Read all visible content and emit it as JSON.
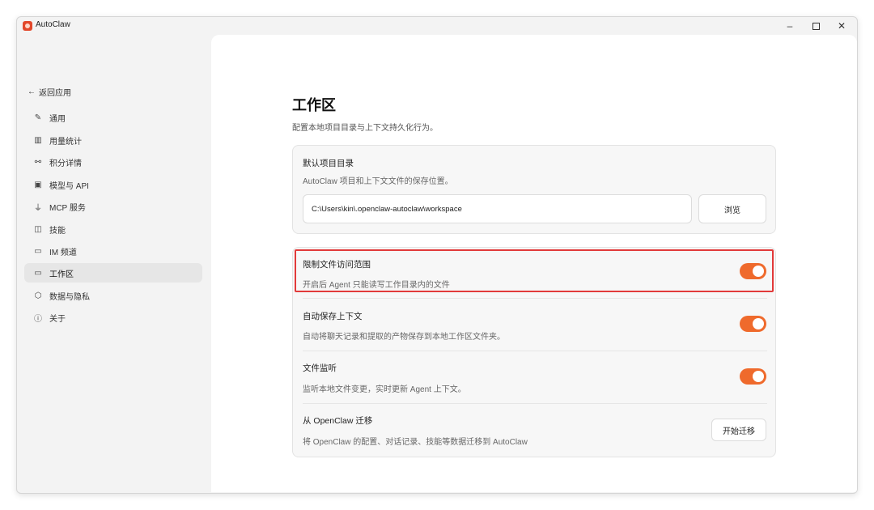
{
  "window": {
    "title": "AutoClaw",
    "minimize": "–",
    "close": "✕"
  },
  "sidebar": {
    "back_label": "返回应用",
    "back_icon": "←",
    "items": [
      {
        "label": "通用",
        "icon": "edit-icon",
        "glyph": "✎"
      },
      {
        "label": "用量统计",
        "icon": "bar-chart-icon",
        "glyph": "▥"
      },
      {
        "label": "积分详情",
        "icon": "link-icon",
        "glyph": "⚯"
      },
      {
        "label": "模型与 API",
        "icon": "chip-icon",
        "glyph": "▣"
      },
      {
        "label": "MCP 服务",
        "icon": "plug-icon",
        "glyph": "⏚"
      },
      {
        "label": "技能",
        "icon": "book-icon",
        "glyph": "◫"
      },
      {
        "label": "IM 频道",
        "icon": "chat-icon",
        "glyph": "▭"
      },
      {
        "label": "工作区",
        "icon": "folder-icon",
        "glyph": "▭"
      },
      {
        "label": "数据与隐私",
        "icon": "shield-icon",
        "glyph": "⬡"
      },
      {
        "label": "关于",
        "icon": "info-icon",
        "glyph": "ⓘ"
      }
    ],
    "active_index": 7
  },
  "main": {
    "title": "工作区",
    "subtitle": "配置本地项目目录与上下文持久化行为。",
    "default_dir": {
      "title": "默认项目目录",
      "desc": "AutoClaw 项目和上下文文件的保存位置。",
      "path_value": "C:\\Users\\kin\\.openclaw-autoclaw\\workspace",
      "browse_label": "浏览"
    },
    "settings": [
      {
        "title": "限制文件访问范围",
        "desc": "开启后 Agent 只能读写工作目录内的文件",
        "enabled": true,
        "highlighted": true
      },
      {
        "title": "自动保存上下文",
        "desc": "自动将聊天记录和提取的产物保存到本地工作区文件夹。",
        "enabled": true
      },
      {
        "title": "文件监听",
        "desc": "监听本地文件变更，实时更新 Agent 上下文。",
        "enabled": true
      }
    ],
    "migrate": {
      "title": "从 OpenClaw 迁移",
      "desc": "将 OpenClaw 的配置、对话记录、技能等数据迁移到 AutoClaw",
      "button_label": "开始迁移"
    }
  },
  "colors": {
    "accent": "#ef6a2c",
    "highlight_border": "#e23a3a"
  }
}
